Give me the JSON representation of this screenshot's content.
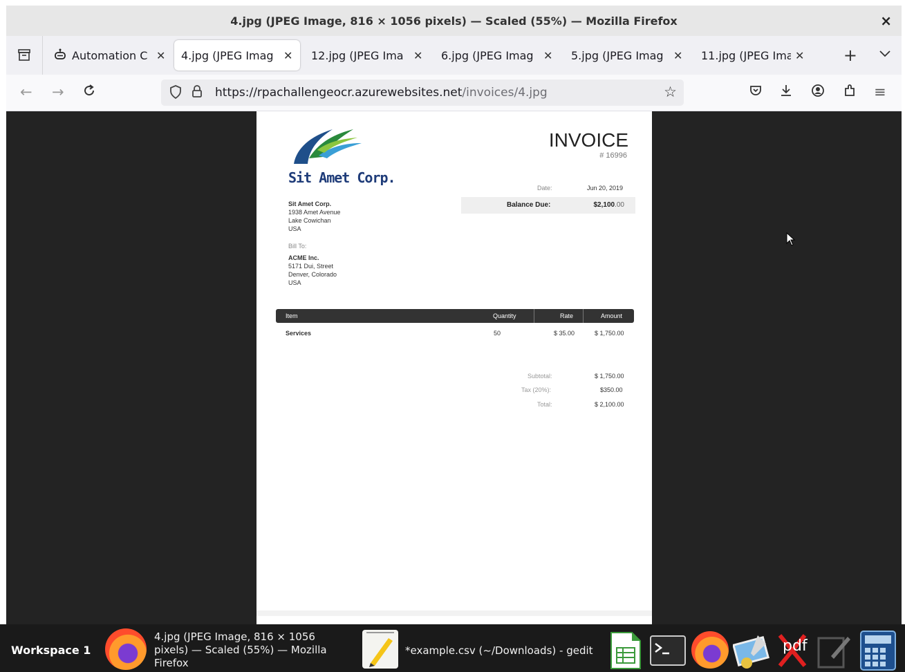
{
  "window": {
    "title": "4.jpg (JPEG Image, 816 × 1056 pixels) — Scaled (55%) — Mozilla Firefox",
    "close_glyph": "×"
  },
  "tabs": [
    {
      "label": "Automation C",
      "icon": "robot-icon",
      "active": false
    },
    {
      "label": "4.jpg (JPEG Imag",
      "active": true
    },
    {
      "label": "12.jpg (JPEG Ima",
      "active": false
    },
    {
      "label": "6.jpg (JPEG Imag",
      "active": false
    },
    {
      "label": "5.jpg (JPEG Imag",
      "active": false
    },
    {
      "label": "11.jpg (JPEG Ima",
      "active": false
    }
  ],
  "navbar": {
    "url_host": "https://rpachallengeocr.azurewebsites.net",
    "url_path": "/invoices/4.jpg"
  },
  "invoice": {
    "company_name": "Sit Amet Corp.",
    "title": "INVOICE",
    "number": "# 16996",
    "date_label": "Date:",
    "date_value": "Jun 20, 2019",
    "balance_label": "Balance Due:",
    "balance_value": "$2,100",
    "balance_cents": ".00",
    "from": {
      "name": "Sit Amet Corp.",
      "street": "1938 Amet Avenue",
      "city": "Lake Cowichan",
      "country": "USA"
    },
    "bill_to_label": "Bill To:",
    "to": {
      "name": "ACME Inc.",
      "street": "5171 Dui, Street",
      "city": "Denver, Colorado",
      "country": "USA"
    },
    "headers": {
      "item": "Item",
      "quantity": "Quantity",
      "rate": "Rate",
      "amount": "Amount"
    },
    "line": {
      "item": "Services",
      "quantity": "50",
      "rate": "$ 35.00",
      "amount": "$ 1,750.00"
    },
    "subtotal_label": "Subtotal:",
    "subtotal_value": "$ 1,750.00",
    "tax_label": "Tax (20%):",
    "tax_value": "$350.00",
    "total_label": "Total:",
    "total_value": "$ 2,100.00"
  },
  "taskbar": {
    "workspace": "Workspace 1",
    "firefox_window": "4.jpg (JPEG Image, 816 × 1056 pixels) — Scaled (55%) — Mozilla Firefox",
    "gedit_window": "*example.csv (~/Downloads) - gedit",
    "pdf_label": "pdf"
  }
}
